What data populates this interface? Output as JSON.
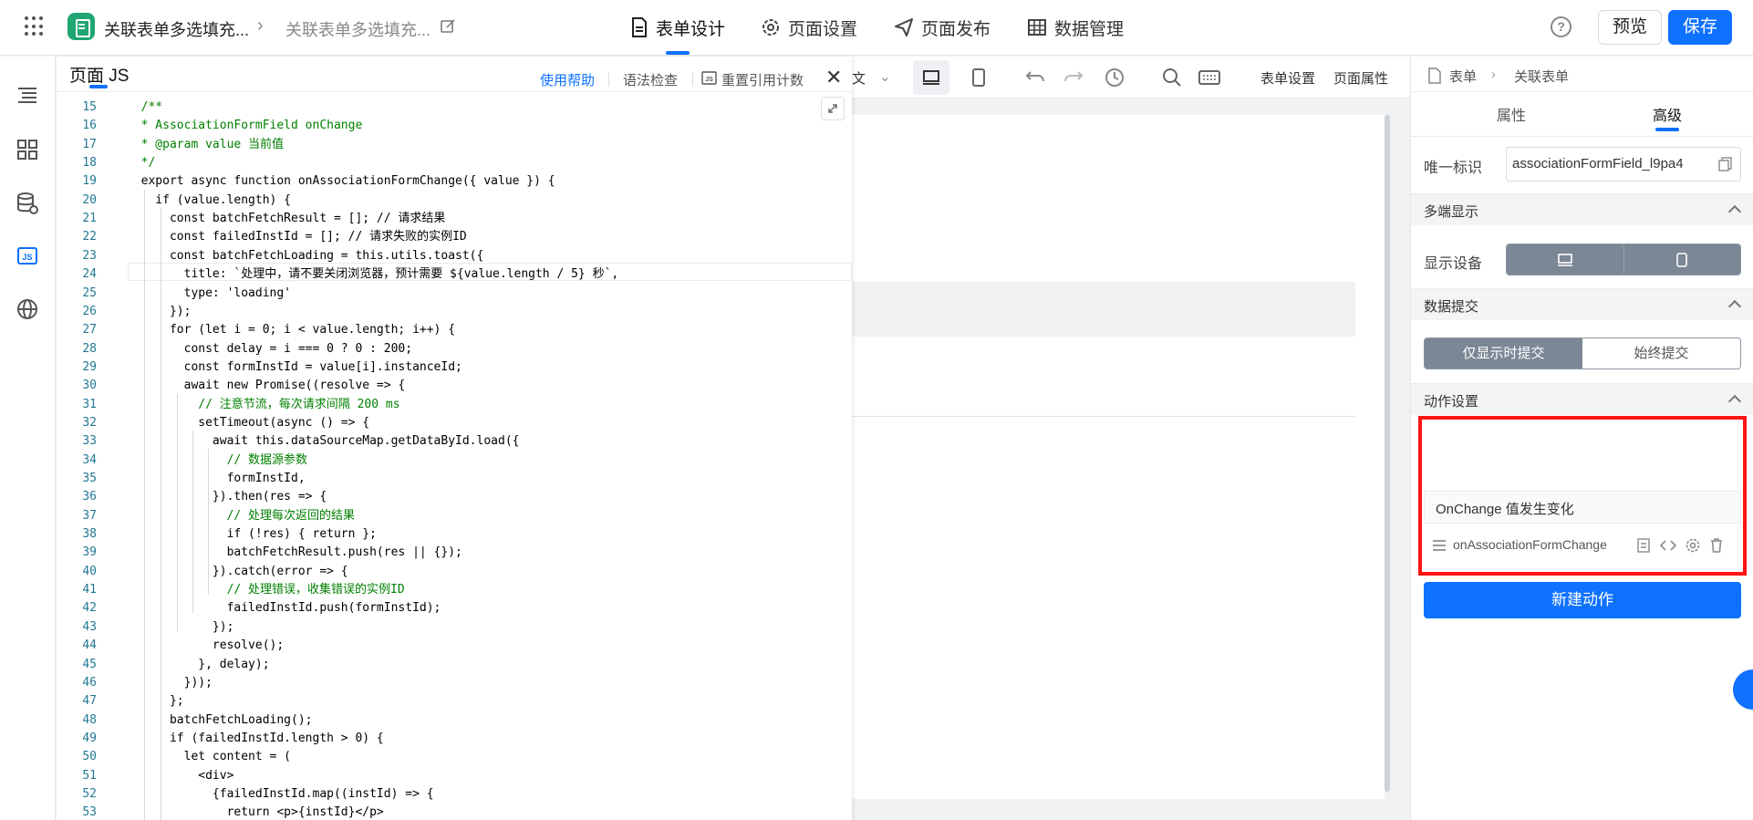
{
  "header": {
    "breadcrumb_app": "关联表单多选填充...",
    "breadcrumb_page": "关联表单多选填充...",
    "tabs": [
      {
        "label": "表单设计",
        "icon": "form-design-icon",
        "active": true
      },
      {
        "label": "页面设置",
        "icon": "gear-icon",
        "active": false
      },
      {
        "label": "页面发布",
        "icon": "send-icon",
        "active": false
      },
      {
        "label": "数据管理",
        "icon": "table-icon",
        "active": false
      }
    ],
    "preview_label": "预览",
    "save_label": "保存"
  },
  "left_sidebar": {
    "icons": [
      "outline-icon",
      "components-icon",
      "datasource-icon",
      "js-icon",
      "globe-icon"
    ]
  },
  "js_panel": {
    "title": "页面 JS",
    "help_link": "使用帮助",
    "syntax_check": "语法检查",
    "reset_ref": "重置引用计数",
    "code_lines": [
      {
        "n": "15",
        "t": "  /**",
        "c": "#008000"
      },
      {
        "n": "16",
        "t": "  * AssociationFormField onChange",
        "c": "#008000"
      },
      {
        "n": "17",
        "t": "  * @param value 当前值",
        "c": "#008000"
      },
      {
        "n": "18",
        "t": "  */",
        "c": "#008000"
      },
      {
        "n": "19",
        "t": "  export async function onAssociationFormChange({ value }) {",
        "c": "#000"
      },
      {
        "n": "20",
        "t": "    if (value.length) {",
        "c": "#000"
      },
      {
        "n": "21",
        "t": "      const batchFetchResult = []; // 请求结果",
        "c": "#000"
      },
      {
        "n": "22",
        "t": "      const failedInstId = []; // 请求失败的实例ID",
        "c": "#000"
      },
      {
        "n": "23",
        "t": "      const batchFetchLoading = this.utils.toast({",
        "c": "#000"
      },
      {
        "n": "24",
        "t": "        title: `处理中，请不要关闭浏览器，预计需要 ${value.length / 5} 秒`,",
        "c": "#000"
      },
      {
        "n": "25",
        "t": "        type: 'loading'",
        "c": "#000"
      },
      {
        "n": "26",
        "t": "      });",
        "c": "#000"
      },
      {
        "n": "27",
        "t": "      for (let i = 0; i < value.length; i++) {",
        "c": "#000"
      },
      {
        "n": "28",
        "t": "        const delay = i === 0 ? 0 : 200;",
        "c": "#000"
      },
      {
        "n": "29",
        "t": "        const formInstId = value[i].instanceId;",
        "c": "#000"
      },
      {
        "n": "30",
        "t": "        await new Promise((resolve => {",
        "c": "#000"
      },
      {
        "n": "31",
        "t": "          // 注意节流，每次请求间隔 200 ms",
        "c": "#008000"
      },
      {
        "n": "32",
        "t": "          setTimeout(async () => {",
        "c": "#000"
      },
      {
        "n": "33",
        "t": "            await this.dataSourceMap.getDataById.load({",
        "c": "#000"
      },
      {
        "n": "34",
        "t": "              // 数据源参数",
        "c": "#008000"
      },
      {
        "n": "35",
        "t": "              formInstId,",
        "c": "#000"
      },
      {
        "n": "36",
        "t": "            }).then(res => {",
        "c": "#000"
      },
      {
        "n": "37",
        "t": "              // 处理每次返回的结果",
        "c": "#008000"
      },
      {
        "n": "38",
        "t": "              if (!res) { return };",
        "c": "#000"
      },
      {
        "n": "39",
        "t": "              batchFetchResult.push(res || {});",
        "c": "#000"
      },
      {
        "n": "40",
        "t": "            }).catch(error => {",
        "c": "#000"
      },
      {
        "n": "41",
        "t": "              // 处理错误，收集错误的实例ID",
        "c": "#008000"
      },
      {
        "n": "42",
        "t": "              failedInstId.push(formInstId);",
        "c": "#000"
      },
      {
        "n": "43",
        "t": "            });",
        "c": "#000"
      },
      {
        "n": "44",
        "t": "            resolve();",
        "c": "#000"
      },
      {
        "n": "45",
        "t": "          }, delay);",
        "c": "#000"
      },
      {
        "n": "46",
        "t": "        }));",
        "c": "#000"
      },
      {
        "n": "47",
        "t": "      };",
        "c": "#000"
      },
      {
        "n": "48",
        "t": "      batchFetchLoading();",
        "c": "#000"
      },
      {
        "n": "49",
        "t": "      if (failedInstId.length > 0) {",
        "c": "#000"
      },
      {
        "n": "50",
        "t": "        let content = (",
        "c": "#000"
      },
      {
        "n": "51",
        "t": "          <div>",
        "c": "#000"
      },
      {
        "n": "52",
        "t": "            {failedInstId.map((instId) => {",
        "c": "#000"
      },
      {
        "n": "53",
        "t": "              return <p>{instId}</p>",
        "c": "#000"
      }
    ]
  },
  "canvas_toolbar": {
    "lang_fragment": "文",
    "form_settings": "表单设置",
    "page_props": "页面属性"
  },
  "right_panel": {
    "breadcrumb": [
      "表单",
      "关联表单"
    ],
    "tabs": [
      "属性",
      "高级"
    ],
    "active_tab": "高级",
    "unique_id_label": "唯一标识",
    "unique_id_value": "associationFormField_l9pa4",
    "multi_display_title": "多端显示",
    "display_device_label": "显示设备",
    "data_submit_title": "数据提交",
    "submit_options": [
      "仅显示时提交",
      "始终提交"
    ],
    "submit_selected": "仅显示时提交",
    "action_title": "动作设置",
    "onchange_label": "OnChange 值发生变化",
    "action_name": "onAssociationFormChange",
    "new_action_label": "新建动作"
  },
  "colors": {
    "primary": "#0e71ff",
    "highlight_box": "#ff1414",
    "app_logo": "#1fa672"
  }
}
